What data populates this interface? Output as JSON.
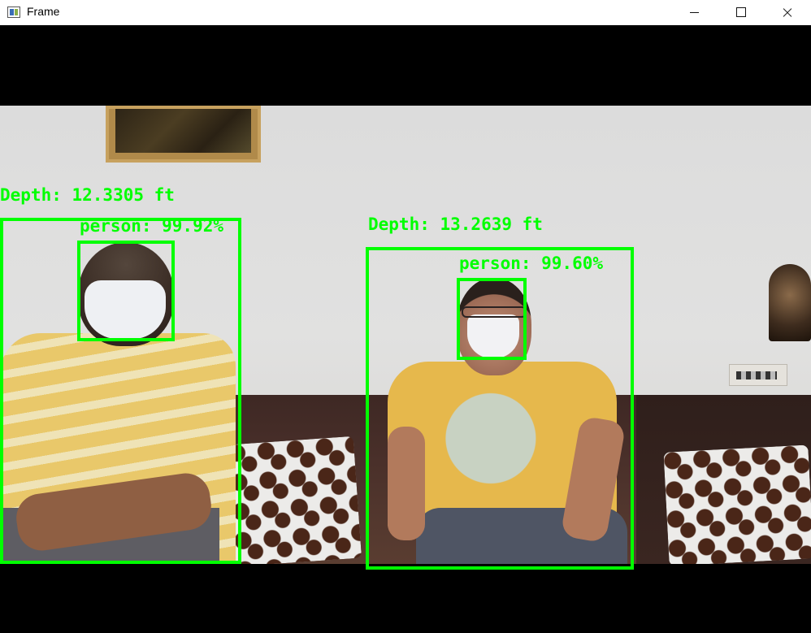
{
  "window": {
    "title": "Frame",
    "icon": "app-window-icon",
    "controls": [
      "minimize-icon",
      "maximize-icon",
      "close-icon"
    ]
  },
  "colors": {
    "detection": "#00ff00",
    "titlebar": "#ffffff",
    "letterbox": "#000000"
  },
  "detections": [
    {
      "depth_label": "Depth: 12.3305 ft",
      "face_label": "person: 99.92%"
    },
    {
      "depth_label": "Depth: 13.2639 ft",
      "face_label": "person: 99.60%"
    }
  ]
}
